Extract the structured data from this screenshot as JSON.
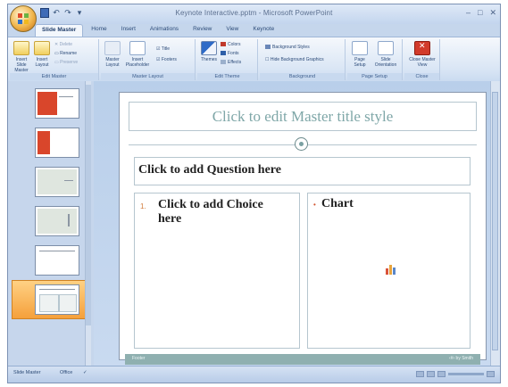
{
  "window": {
    "title": "Keynote Interactive.pptm - Microsoft PowerPoint",
    "controls": [
      "–",
      "□",
      "✕"
    ]
  },
  "tabs": [
    "Slide Master",
    "Home",
    "Insert",
    "Animations",
    "Review",
    "View",
    "Keynote"
  ],
  "ribbon": {
    "groups": [
      {
        "label": "Edit Master",
        "buttons": [
          "Insert Slide Master",
          "Insert Layout"
        ],
        "small": [
          "Delete",
          "Rename",
          "Preserve"
        ]
      },
      {
        "label": "Master Layout",
        "buttons": [
          "Master Layout",
          "Insert Placeholder"
        ],
        "small": [
          "Title",
          "Footers"
        ]
      },
      {
        "label": "Edit Theme",
        "buttons": [
          "Themes"
        ],
        "small": [
          "Colors",
          "Fonts",
          "Effects"
        ]
      },
      {
        "label": "Background",
        "buttons": [],
        "small": [
          "Background Styles",
          "Hide Background Graphics"
        ]
      },
      {
        "label": "Page Setup",
        "buttons": [
          "Page Setup",
          "Slide Orientation"
        ],
        "small": []
      },
      {
        "label": "Close",
        "buttons": [
          "Close Master View"
        ],
        "small": []
      }
    ]
  },
  "slide": {
    "title_placeholder": "Click to edit Master title style",
    "question": "Click to add Question here",
    "choice_number": "1.",
    "choice": "Click to add Choice here",
    "chart_bullet": "•",
    "chart_label": "Chart",
    "footer_left": "Footer",
    "footer_right": "‹#› by Smith"
  },
  "statusbar": {
    "view_label": "Slide Master",
    "theme_label": "Office"
  },
  "colors": {
    "title_text": "#7fa7a8",
    "footer_bar": "#8fb0b0",
    "thumb_selected": "#f5a03b",
    "thumb_red": "#d9462b"
  }
}
